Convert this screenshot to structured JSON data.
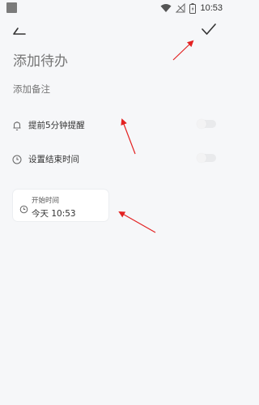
{
  "status_bar": {
    "time": "10:53"
  },
  "app_bar": {
    "back_icon": "back-icon",
    "confirm_icon": "check-icon"
  },
  "todo": {
    "title_placeholder": "添加待办",
    "note_placeholder": "添加备注"
  },
  "settings": [
    {
      "icon": "bell-icon",
      "label": "提前5分钟提醒",
      "enabled": false
    },
    {
      "icon": "clock-icon",
      "label": "设置结束时间",
      "enabled": false
    }
  ],
  "start_time": {
    "caption": "开始时间",
    "value": "今天 10:53"
  },
  "colors": {
    "background": "#f6f7f9",
    "annotation_arrow": "#e32222"
  }
}
